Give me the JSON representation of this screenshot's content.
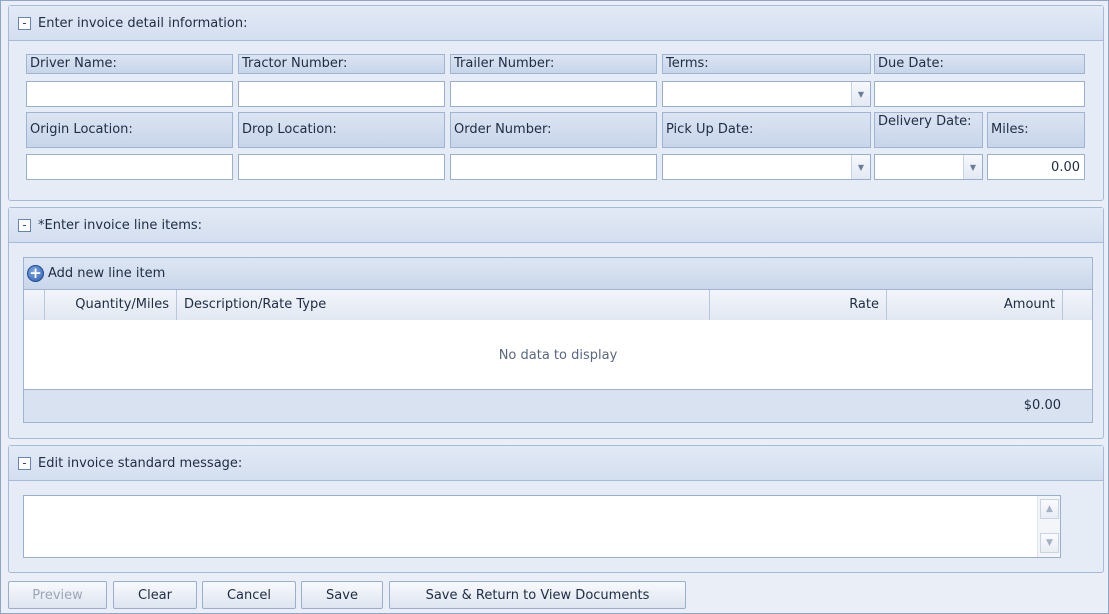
{
  "detail_panel": {
    "title": "Enter invoice detail information:",
    "collapse": "-",
    "row1": {
      "driver_name": "Driver Name:",
      "tractor_number": "Tractor Number:",
      "trailer_number": "Trailer Number:",
      "terms": "Terms:",
      "due_date": "Due Date:"
    },
    "row2": {
      "origin_location": "Origin Location:",
      "drop_location": "Drop Location:",
      "order_number": "Order Number:",
      "pick_up_date": "Pick Up Date:",
      "delivery_date": "Delivery Date:",
      "miles": "Miles:"
    },
    "values": {
      "driver_name": "",
      "tractor_number": "",
      "trailer_number": "",
      "terms": "",
      "due_date": "",
      "origin_location": "",
      "drop_location": "",
      "order_number": "",
      "pick_up_date": "",
      "delivery_date": "",
      "miles": "0.00"
    }
  },
  "line_items_panel": {
    "title": "*Enter invoice line items:",
    "collapse": "-",
    "add_label": "Add new line item",
    "columns": [
      "Quantity/Miles",
      "Description/Rate Type",
      "Rate",
      "Amount"
    ],
    "empty_text": "No data to display",
    "total": "$0.00"
  },
  "message_panel": {
    "title": "Edit invoice standard message:",
    "collapse": "-",
    "message": ""
  },
  "buttons": {
    "preview": "Preview",
    "clear": "Clear",
    "cancel": "Cancel",
    "save": "Save",
    "save_return": "Save & Return to View Documents"
  },
  "icons": {
    "dropdown": "chevron-down-icon",
    "add": "plus-circle-icon",
    "scroll_up": "scroll-up-icon",
    "scroll_down": "scroll-down-icon"
  }
}
